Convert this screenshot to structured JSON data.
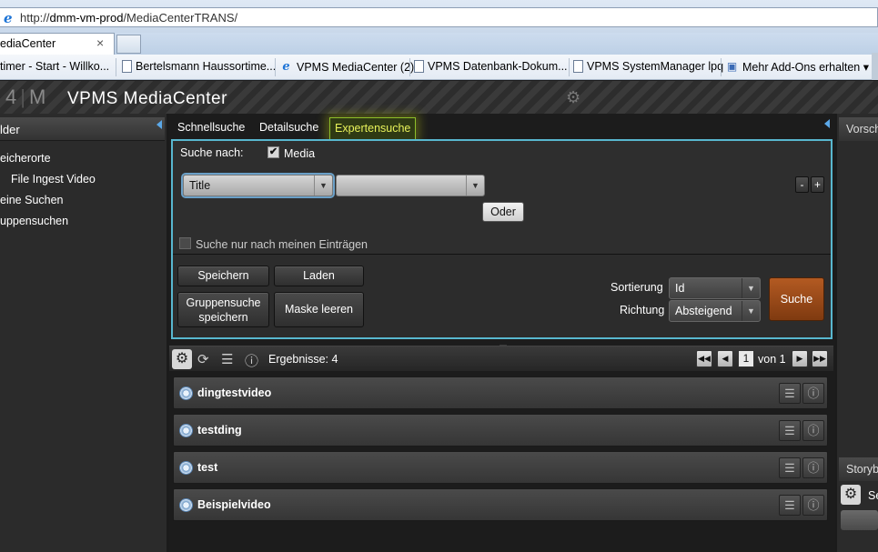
{
  "browser": {
    "url_prefix": "http://",
    "url_host": "dmm-vm-prod",
    "url_path": "/MediaCenterTRANS/",
    "tab_title": "ediaCenter",
    "tab_close": "×",
    "favorites": [
      {
        "label": "timer - Start - Willko...",
        "icon": "page"
      },
      {
        "label": "Bertelsmann Haussortime...",
        "icon": "page"
      },
      {
        "label": "VPMS MediaCenter (2)",
        "icon": "ie"
      },
      {
        "label": "VPMS Datenbank-Dokum...",
        "icon": "page"
      },
      {
        "label": "VPMS SystemManager lpq",
        "icon": "page"
      },
      {
        "label": "Mehr Add-Ons erhalten ▾",
        "icon": "addon"
      }
    ]
  },
  "app": {
    "logo_a": "4",
    "logo_b": "M",
    "title": "VPMS MediaCenter"
  },
  "sidebar": {
    "header": "lder",
    "items": [
      "eicherorte",
      "File Ingest Video",
      "eine Suchen",
      "uppensuchen"
    ]
  },
  "search": {
    "tabs": [
      "Schnellsuche",
      "Detailsuche",
      "Expertensuche"
    ],
    "active_tab": "Expertensuche",
    "search_for_label": "Suche nach:",
    "media_label": "Media",
    "media_checked": "✔",
    "field_select": "Title",
    "operator_select": "",
    "minus": "-",
    "plus": "+",
    "or_button": "Oder",
    "only_mine_label": "Suche nur nach meinen Einträgen",
    "save_button": "Speichern",
    "load_button": "Laden",
    "group_save_line1": "Gruppensuche",
    "group_save_line2": "speichern",
    "clear_button": "Maske leeren",
    "sort_label": "Sortierung",
    "sort_value": "Id",
    "direction_label": "Richtung",
    "direction_value": "Absteigend",
    "search_button": "Suche"
  },
  "results": {
    "count_label": "Ergebnisse: 4",
    "page": "1",
    "of_pages": "von 1",
    "items": [
      "dingtestvideo",
      "testding",
      "test",
      "Beispielvideo"
    ]
  },
  "right_panel": {
    "header": "Vorsch",
    "header2": "Storyb",
    "gear_label": "Se"
  },
  "colors": {
    "accent_cyan": "#58b7cf",
    "active_tab_text": "#e8f25a",
    "search_button": "#b35a22"
  }
}
